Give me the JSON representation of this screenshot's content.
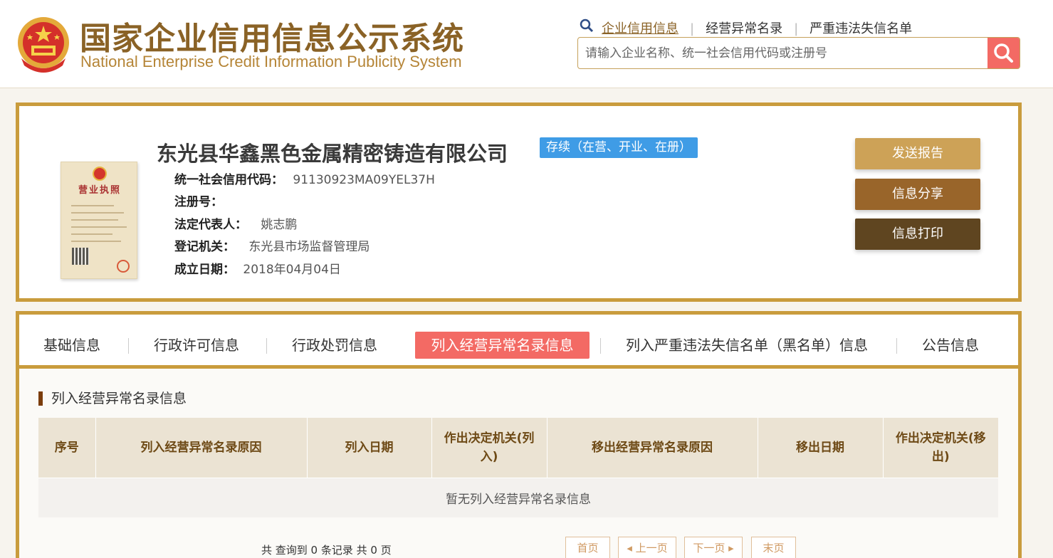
{
  "header": {
    "title_cn": "国家企业信用信息公示系统",
    "title_en": "National Enterprise Credit Information Publicity System",
    "links": [
      "企业信用信息",
      "经营异常名录",
      "严重违法失信名单"
    ],
    "search_placeholder": "请输入企业名称、统一社会信用代码或注册号"
  },
  "company": {
    "name": "东光县华鑫黑色金属精密铸造有限公司",
    "status": "存续（在营、开业、在册）",
    "license_title": "营业执照",
    "fields": [
      {
        "label": "统一社会信用代码：",
        "value": "91130923MA09YEL37H"
      },
      {
        "label": "注册号：",
        "value": ""
      },
      {
        "label": "法定代表人：",
        "value": "姚志鹏"
      },
      {
        "label": "登记机关：",
        "value": "东光县市场监督管理局"
      },
      {
        "label": "成立日期：",
        "value": "2018年04月04日"
      }
    ],
    "actions": [
      "发送报告",
      "信息分享",
      "信息打印"
    ]
  },
  "tabs": [
    "基础信息",
    "行政许可信息",
    "行政处罚信息",
    "列入经营异常名录信息",
    "列入严重违法失信名单（黑名单）信息",
    "公告信息"
  ],
  "section": {
    "title": "列入经营异常名录信息",
    "columns": [
      "序号",
      "列入经营异常名录原因",
      "列入日期",
      "作出决定机关(列入)",
      "移出经营异常名录原因",
      "移出日期",
      "作出决定机关(移出)"
    ],
    "empty_message": "暂无列入经营异常名录信息"
  },
  "pager": {
    "summary": "共 查询到 0 条记录 共 0 页",
    "first": "首页",
    "prev": "◂ 上一页",
    "next": "下一页 ▸",
    "last": "末页"
  },
  "colors": {
    "gold": "#c99c3d",
    "brown_title": "#8a6226",
    "accent_red": "#f36a64",
    "status_blue": "#3f9ce6",
    "btn_send": "#cda257",
    "btn_share": "#99652a",
    "btn_print": "#5f4520"
  }
}
